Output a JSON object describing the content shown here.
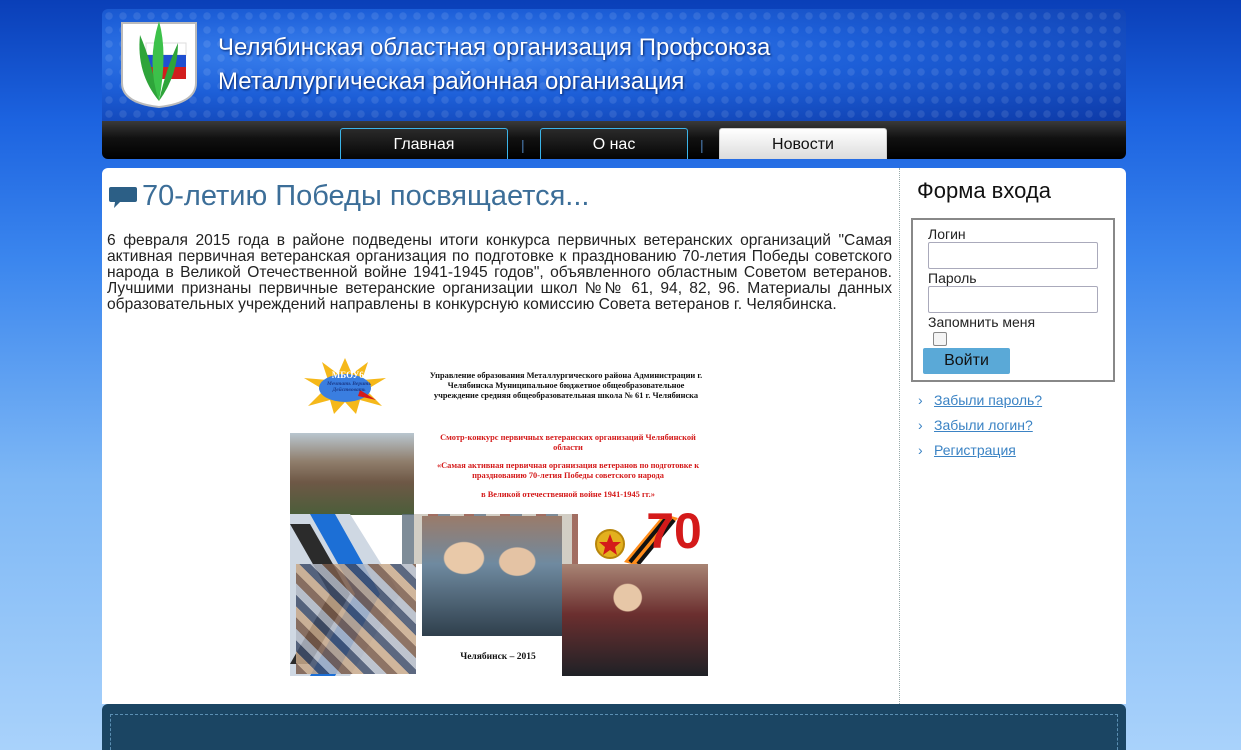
{
  "header": {
    "title_line1": "Челябинская областная организация Профсоюза",
    "title_line2": "Металлургическая районная организация"
  },
  "nav": {
    "items": [
      {
        "label": "Главная",
        "active": false
      },
      {
        "label": "О нас",
        "active": false
      },
      {
        "label": "Новости",
        "active": true
      }
    ],
    "separator": "|"
  },
  "article": {
    "title": "70-летию Победы посвящается...",
    "body": "6 февраля 2015 года в районе подведены итоги конкурса первичных ветеранских организаций \"Самая активная первичная ветеранская организация по подготовке к празднованию 70-летия Победы советского народа в Великой Отечественной войне 1941-1945 годов\", объявленного областным Советом ветеранов. Лучшими признаны первичные ветеранские организации школ №№ 61, 94, 82, 96. Материалы данных образовательных  учреждений направлены в конкурсную комиссию Совета ветеранов г. Челябинска.",
    "poster": {
      "header_text": "Управление образования Металлургического района Администрации г. Челябинска Муниципальное бюджетное общеобразовательное учреждение средняя общеобразовательная школа № 61 г. Челябинска",
      "contest_title": "Смотр-конкурс первичных ветеранских организаций Челябинской области",
      "contest_subtitle": "«Самая активная первичная организация ветеранов по подготовке к празднованию 70-летия Победы советского народа",
      "contest_years": "в Великой отечественной войне 1941-1945 гг.»",
      "school_badge": "МБОУ61",
      "badge_caption": "Мечтать Верить Действовать",
      "big_number": "70",
      "city_year": "Челябинск – 2015"
    }
  },
  "sidebar": {
    "form_title": "Форма входа",
    "login_label": "Логин",
    "password_label": "Пароль",
    "remember_label": "Запомнить меня",
    "submit_label": "Войти",
    "links": [
      "Забыли пароль?",
      "Забыли логин?",
      "Регистрация"
    ]
  },
  "colors": {
    "accent": "#3b83c4",
    "title_blue": "#3c6e98",
    "button": "#5aa9d7",
    "footer": "#1b4563",
    "poster_red": "#d41a1a"
  }
}
